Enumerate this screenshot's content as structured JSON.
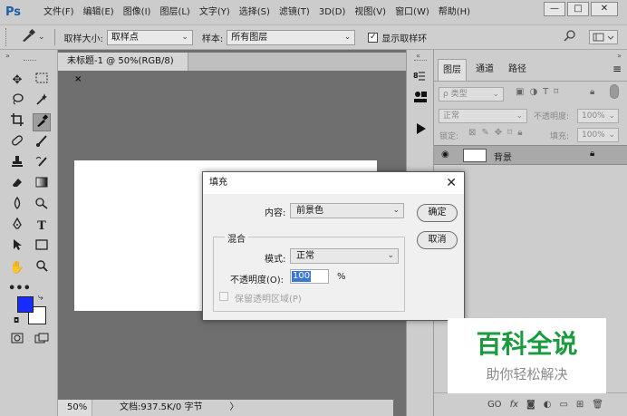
{
  "app": {
    "logo": "Ps"
  },
  "menu": {
    "items": [
      "文件(F)",
      "编辑(E)",
      "图像(I)",
      "图层(L)",
      "文字(Y)",
      "选择(S)",
      "滤镜(T)",
      "3D(D)",
      "视图(V)",
      "窗口(W)",
      "帮助(H)"
    ]
  },
  "window_controls": {
    "minimize": "—",
    "maximize": "□",
    "close": "✕"
  },
  "options": {
    "sample_size_label": "取样大小:",
    "sample_size_value": "取样点",
    "sample_label": "样本:",
    "sample_value": "所有图层",
    "show_ring_label": "显示取样环",
    "show_ring_checked": true
  },
  "document": {
    "tab_title": "未标题-1 @ 50%(RGB/8)",
    "tab_close": "×",
    "zoom": "50%",
    "doc_info": "文档:937.5K/0 字节",
    "arrow": "〉"
  },
  "tools": {
    "foreground_color": "#1a2bff",
    "background_color": "#ffffff"
  },
  "layers_panel": {
    "tabs": [
      "图层",
      "通道",
      "路径"
    ],
    "filter_label": "ρ 类型",
    "blend_mode": "正常",
    "opacity_label": "不透明度:",
    "opacity_value": "100%",
    "lock_label": "锁定:",
    "fill_label": "填充:",
    "fill_value": "100%",
    "layer_name": "背景",
    "bottom_icons": [
      "GO",
      "fx"
    ]
  },
  "fill_dialog": {
    "title": "填充",
    "close": "✕",
    "content_label": "内容:",
    "content_value": "前景色",
    "ok_label": "确定",
    "cancel_label": "取消",
    "blend_group_label": "混合",
    "mode_label": "模式:",
    "mode_value": "正常",
    "opacity_label": "不透明度(O):",
    "opacity_value": "100",
    "opacity_unit": "%",
    "preserve_label": "保留透明区域(P)",
    "preserve_checked": false
  },
  "watermark": {
    "title": "百科全说",
    "subtitle": "助你轻松解决",
    "title_color": "#1b9a3e"
  }
}
